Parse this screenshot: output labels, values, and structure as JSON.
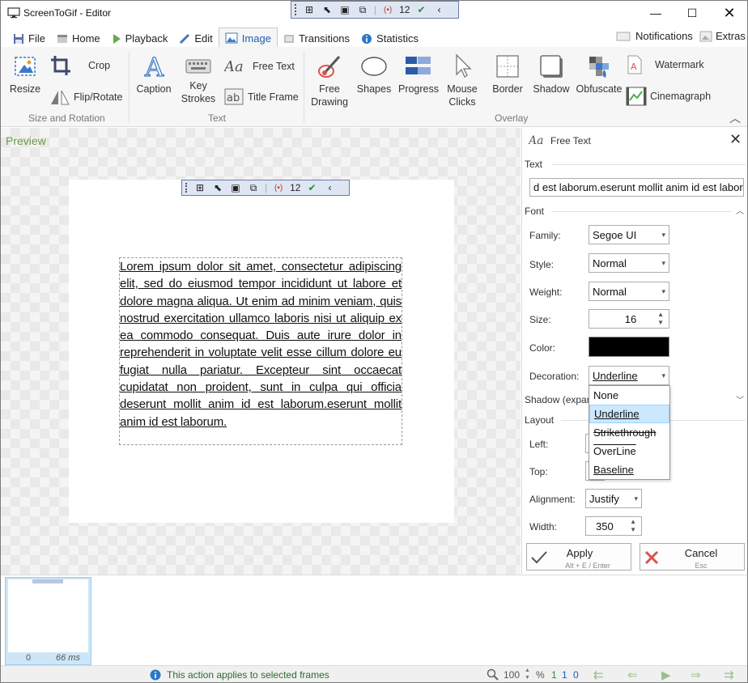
{
  "window": {
    "title": "ScreenToGif - Editor"
  },
  "recorder_toolbar": {
    "frame_count": "12"
  },
  "menu": {
    "tabs": [
      {
        "label": "File",
        "icon": "save-icon"
      },
      {
        "label": "Home",
        "icon": "home-icon"
      },
      {
        "label": "Playback",
        "icon": "play-icon"
      },
      {
        "label": "Edit",
        "icon": "pencil-icon"
      },
      {
        "label": "Image",
        "icon": "image-icon"
      },
      {
        "label": "Transitions",
        "icon": "transitions-icon"
      },
      {
        "label": "Statistics",
        "icon": "info-icon"
      }
    ],
    "active_tab": "Image",
    "notifications_label": "Notifications",
    "extras_label": "Extras"
  },
  "ribbon": {
    "resize": "Resize",
    "crop": "Crop",
    "flip_rotate": "Flip/Rotate",
    "group_size_rotation": "Size and Rotation",
    "caption": "Caption",
    "key_strokes_1": "Key",
    "key_strokes_2": "Strokes",
    "free_text": "Free Text",
    "title_frame": "Title Frame",
    "group_text": "Text",
    "free_drawing_1": "Free",
    "free_drawing_2": "Drawing",
    "shapes": "Shapes",
    "progress": "Progress",
    "mouse_clicks_1": "Mouse",
    "mouse_clicks_2": "Clicks",
    "border": "Border",
    "shadow": "Shadow",
    "obfuscate": "Obfuscate",
    "watermark": "Watermark",
    "cinemagraph": "Cinemagraph",
    "group_overlay": "Overlay"
  },
  "preview": {
    "label": "Preview",
    "text": "Lorem ipsum dolor sit amet, consectetur adipiscing elit, sed do eiusmod tempor incididunt ut labore et dolore magna aliqua. Ut enim ad minim veniam, quis nostrud exercitation ullamco laboris nisi ut aliquip ex ea commodo consequat. Duis aute irure dolor in reprehenderit in voluptate velit esse cillum dolore eu fugiat nulla pariatur. Excepteur sint occaecat cupidatat non proident, sunt in culpa qui officia deserunt mollit anim id est laborum.eserunt mollit anim id est laborum."
  },
  "panel": {
    "title": "Free Text",
    "text_section": "Text",
    "text_value": "d est laborum.eserunt mollit anim id est laborum.",
    "font_section": "Font",
    "family_label": "Family:",
    "family_value": "Segoe UI",
    "style_label": "Style:",
    "style_value": "Normal",
    "weight_label": "Weight:",
    "weight_value": "Normal",
    "size_label": "Size:",
    "size_value": "16",
    "color_label": "Color:",
    "color_value": "#000000",
    "decoration_label": "Decoration:",
    "decoration_value": "Underline",
    "decoration_options": [
      "None",
      "Underline",
      "Strikethrough",
      "OverLine",
      "Baseline"
    ],
    "shadow_section": "Shadow (expan",
    "layout_section": "Layout",
    "left_label": "Left:",
    "top_label": "Top:",
    "alignment_label": "Alignment:",
    "alignment_value": "Justify",
    "width_label": "Width:",
    "width_value": "350",
    "apply_label": "Apply",
    "apply_shortcut": "Alt + E / Enter",
    "cancel_label": "Cancel",
    "cancel_shortcut": "Esc"
  },
  "filmstrip": {
    "frame_index": "0",
    "frame_delay": "66 ms"
  },
  "status": {
    "message": "This action applies to selected frames",
    "zoom": "100",
    "zoom_unit": "%",
    "sel_1": "1",
    "sel_2": "1",
    "sel_3": "0"
  }
}
